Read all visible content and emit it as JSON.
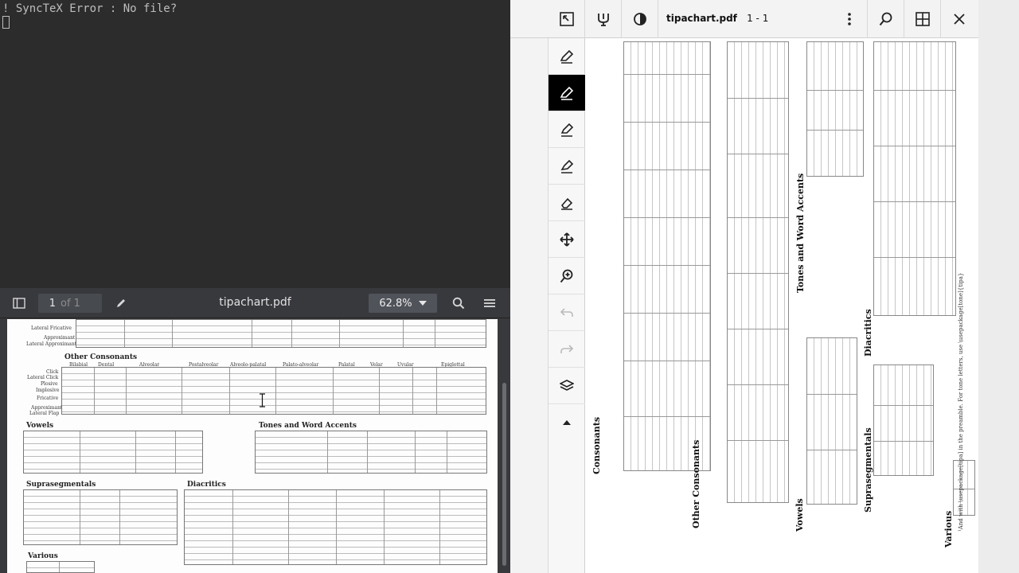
{
  "terminal": {
    "error_line": "! SyncTeX Error : No file?"
  },
  "viewer": {
    "page_current": "1",
    "page_total": "of 1",
    "title": "tipachart.pdf",
    "zoom": "62.8%",
    "sections": {
      "other_consonants": "Other Consonants",
      "vowels": "Vowels",
      "tones": "Tones and Word Accents",
      "suprasegmentals": "Suprasegmentals",
      "diacritics": "Diacritics",
      "various": "Various"
    },
    "row_labels": [
      "Lateral Fricative",
      "Approximant",
      "Lateral Approximant"
    ],
    "oc_headers": [
      "Bilabial",
      "Dental",
      "Alveolar",
      "Postalveolar",
      "Alveolo-palatal",
      "Palato-alveolar",
      "Palatal",
      "Velar",
      "Uvular",
      "Epiglottal"
    ],
    "oc_rows": [
      "Click",
      "Lateral Click",
      "Plosive",
      "Implosive",
      "Fricative",
      "Approximant",
      "Lateral Flap"
    ]
  },
  "rviewer": {
    "title": "tipachart.pdf",
    "pages": "1 - 1",
    "sections": {
      "consonants": "Consonants",
      "other_consonants": "Other Consonants",
      "vowels": "Vowels",
      "suprasegmentals": "Suprasegmentals",
      "diacritics": "Diacritics",
      "tones": "Tones and Word Accents",
      "various": "Various"
    },
    "footnote": "¹And with \\usepackage[tipa] in the preamble. For tone letters, use \\usepackage[tone]{tipa}"
  },
  "colors": {
    "terminal_bg": "#2c2c2c",
    "viewer_toolbar": "#38393d",
    "right_toolbar": "#f3f3f3",
    "active_tool": "#000000"
  }
}
